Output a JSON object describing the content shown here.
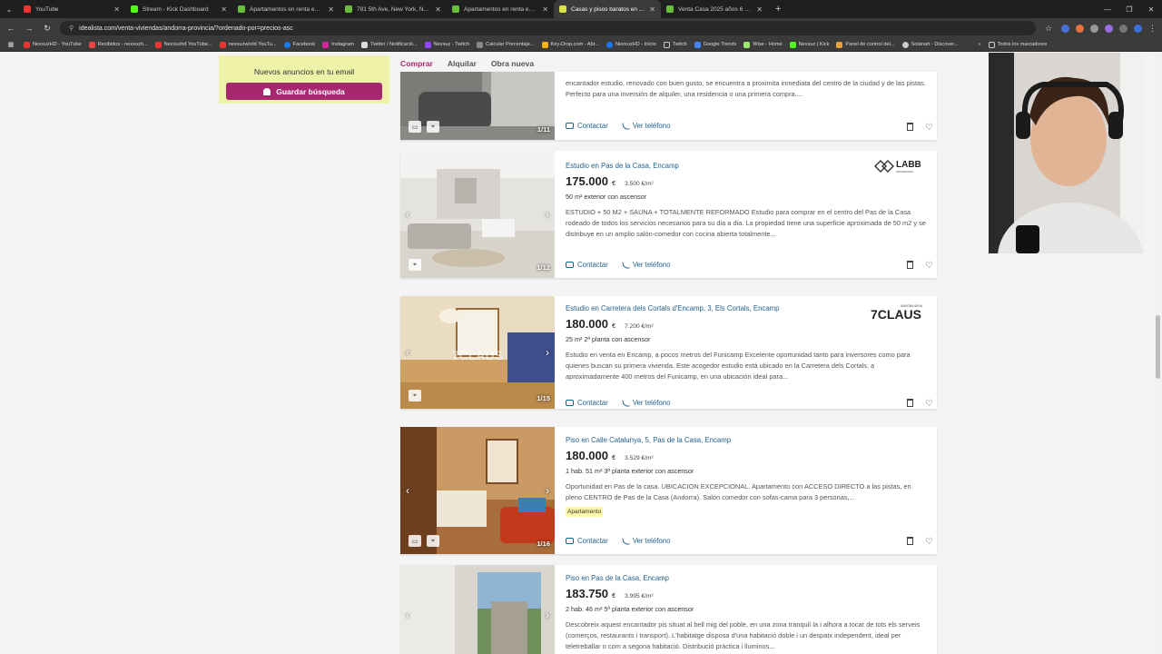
{
  "browser": {
    "tabs": [
      {
        "label": "YouTube",
        "color": "#e33"
      },
      {
        "label": "Stream - Kick Dashboard",
        "color": "#53fc18"
      },
      {
        "label": "Apartamentos en renta en New...",
        "color": "#6cbf3c"
      },
      {
        "label": "781 5th Ave, New York, NY 10...",
        "color": "#6cbf3c"
      },
      {
        "label": "Apartamentos en renta en Las...",
        "color": "#6cbf3c"
      },
      {
        "label": "Casas y pisos baratos en Ando...",
        "color": "#d7e54a",
        "active": true
      },
      {
        "label": "Venta Casa 2025 años 6 dormi...",
        "color": "#6cbf3c"
      }
    ],
    "url": "idealista.com/venta-viviendas/andorra-provincia/?ordenado-por=precios-asc",
    "bookmarks": [
      {
        "label": "NexxuzHD - YouTube",
        "color": "#e33"
      },
      {
        "label": "Recibidos - nexxuzh...",
        "color": "#e44"
      },
      {
        "label": "Nexxuzhd YouTube...",
        "color": "#e33"
      },
      {
        "label": "nexxuzworld YouTu...",
        "color": "#e33"
      },
      {
        "label": "Facebook",
        "color": "#1877f2"
      },
      {
        "label": "Instagram",
        "color": "#d6249f"
      },
      {
        "label": "Twitter / Notificació...",
        "color": "#ddd"
      },
      {
        "label": "Nexxuz - Twitch",
        "color": "#9146ff"
      },
      {
        "label": "Calcular Porcentaje...",
        "color": "#888"
      },
      {
        "label": "Key-Drop.com - Abr...",
        "color": "#f7b500"
      },
      {
        "label": "NexxuzHD - Inicio",
        "color": "#1877f2"
      },
      {
        "label": "Twitch",
        "color": "#ccc"
      },
      {
        "label": "Google Trends",
        "color": "#4285f4"
      },
      {
        "label": "Wise - Home",
        "color": "#9fe870"
      },
      {
        "label": "Nexxuz | Kick",
        "color": "#53fc18"
      },
      {
        "label": "Panel de control del...",
        "color": "#e8a33d"
      },
      {
        "label": "Solanart - Discover...",
        "color": "#ccc"
      }
    ],
    "bookmarks_all": "Todos los marcadores"
  },
  "sidebar": {
    "alert_title": "Nuevos anuncios en tu email",
    "save_search": "Guardar búsqueda"
  },
  "operation_tabs": [
    "Comprar",
    "Alquilar",
    "Obra nueva"
  ],
  "listing_actions": {
    "contact": "Contactar",
    "phone": "Ver teléfono"
  },
  "listings": [
    {
      "title": "",
      "price": "",
      "price_m2": "",
      "details": "",
      "description": "encantador estudio, renovado con buen gusto, se encuentra a proximita inmediata del centro de la ciudad y de las pistas. Perfecto para una inversión de alquiler, una residencia o una primera compra....",
      "counter": "1/11"
    },
    {
      "title": "Estudio en Pas de la Casa, Encamp",
      "price": "175.000",
      "currency": "€",
      "price_m2": "3.500 €/m²",
      "details": "50 m²  exterior con ascensor",
      "description": "ESTUDIO + 50 M2 + SAUNA + TOTALMENTE REFORMADO Estudio para comprar en el centro del Pas de la Casa rodeado de todos los servicios necesarios para su dia a dia. La propiedad tiene una superficie aproximada de 50 m2 y se distribuye en un amplio salón-comedor con cocina abierta totalmente...",
      "counter": "1/12",
      "agency": "LABB",
      "agency_sub": "PROPERTIES"
    },
    {
      "title": "Estudio en Carretera dels Cortals d'Encamp, 3, Els Cortals, Encamp",
      "price": "180.000",
      "currency": "€",
      "price_m2": "7.200 €/m²",
      "details": "25 m²  2ª planta con ascensor",
      "description": "Estudio en venta en Encamp, a pocos metros del Funicamp Excelente oportunidad tanto para inversores como para quienes buscan su primera vivienda. Este acogedor estudio está ubicado en la Carretera dels Cortals, a aproximadamente 400 metros del Funicamp, en una ubicación ideal para...",
      "counter": "1/15",
      "agency": "7CLAUS",
      "agency_sub": "IMMOBILIÀRIA",
      "watermark": "7CLAUS"
    },
    {
      "title": "Piso en Calle Catalunya, 5, Pas de la Casa, Encamp",
      "price": "180.000",
      "currency": "€",
      "price_m2": "3.529 €/m²",
      "details": "1 hab.  51 m²  3ª planta exterior con ascensor",
      "description": "Oportunidad en Pas de la casa. UBICACION EXCEPCIONAL. Apartamento con ACCESO DIRECTO a las pistas, en pleno CENTRO de Pas de la Casa (Andorra). Salón comedor con sofas-cama para 3 personas,...",
      "tag": "Apartamento",
      "counter": "1/16"
    },
    {
      "title": "Piso en Pas de la Casa, Encamp",
      "price": "183.750",
      "currency": "€",
      "price_m2": "3.995 €/m²",
      "details": "2 hab.  46 m²  5ª planta exterior con ascensor",
      "description": "Descobreix aquest encantador pis situat al bell mig del poble, en una zona tranquil·la i alhora a tocar de tots els serveis (comerços, restaurants i transport). L'habitatge disposa d'una habitació doble i un despatx independent, ideal per teletreballar o com a segona habitació. Distribució pràctica i lluminos..."
    }
  ]
}
